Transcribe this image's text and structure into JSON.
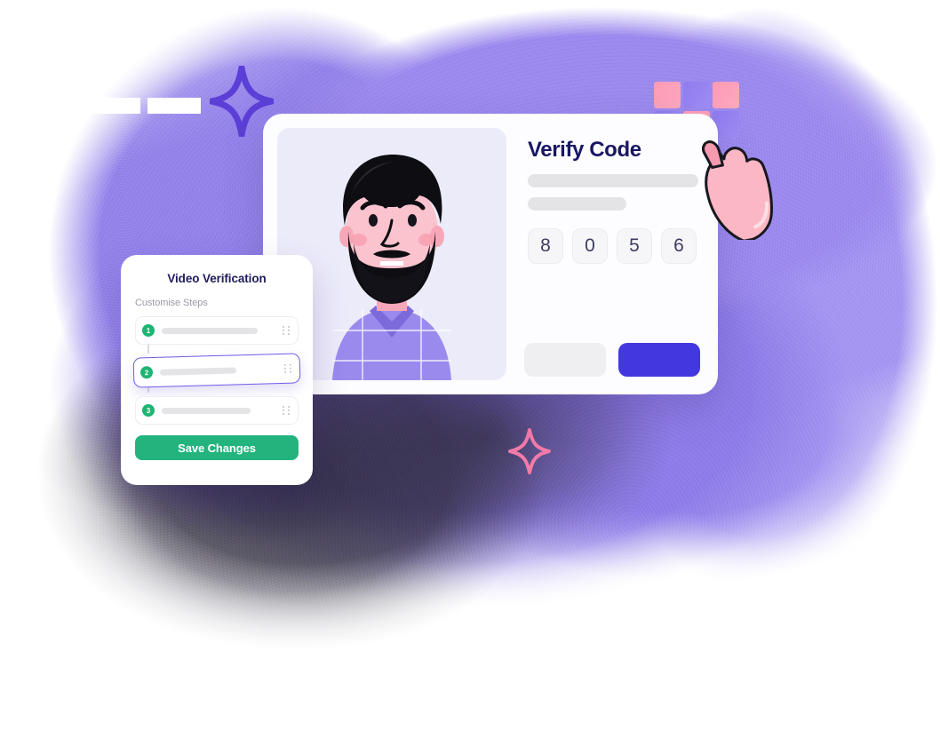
{
  "verify_panel": {
    "title": "Verify Code",
    "photo_alt": "bearded-man-portrait",
    "placeholder_bars": [
      "full",
      "short"
    ],
    "code_digits": [
      "8",
      "0",
      "5",
      "6"
    ],
    "secondary_button_label": "",
    "primary_button_label": "",
    "colors": {
      "title": "#191763",
      "primary_button": "#4338E0",
      "secondary_button": "#EFEFF1",
      "code_box_bg": "#F6F6F8",
      "code_digit": "#3D3C63",
      "photo_panel_bg": "#ECEBFA"
    }
  },
  "steps_panel": {
    "title": "Video Verification",
    "subtitle": "Customise Steps",
    "steps": [
      {
        "number": "1",
        "label": "",
        "active": false,
        "handle": "drag-handle"
      },
      {
        "number": "2",
        "label": "",
        "active": true,
        "handle": "drag-handle"
      },
      {
        "number": "3",
        "label": "",
        "active": false,
        "handle": "drag-handle"
      }
    ],
    "save_label": "Save Changes",
    "colors": {
      "title": "#1F1C5C",
      "subtitle": "#9B9BA6",
      "step_number_bg": "#1FB473",
      "active_border": "#6F5DE8",
      "save_button": "#23B47E"
    }
  },
  "decor": {
    "grid_squares": [
      "pink",
      "purple",
      "pink",
      "purple",
      "pink",
      "purple",
      "purple",
      "purple",
      "empty"
    ],
    "sparkle_top_color": "#5B3FD6",
    "sparkle_bottom_color": "#F47BA8",
    "hand_name": "pointing-hand-illustration",
    "background_blob_color": "#9B89EE",
    "background_smudge_color": "#2C2A3A"
  }
}
